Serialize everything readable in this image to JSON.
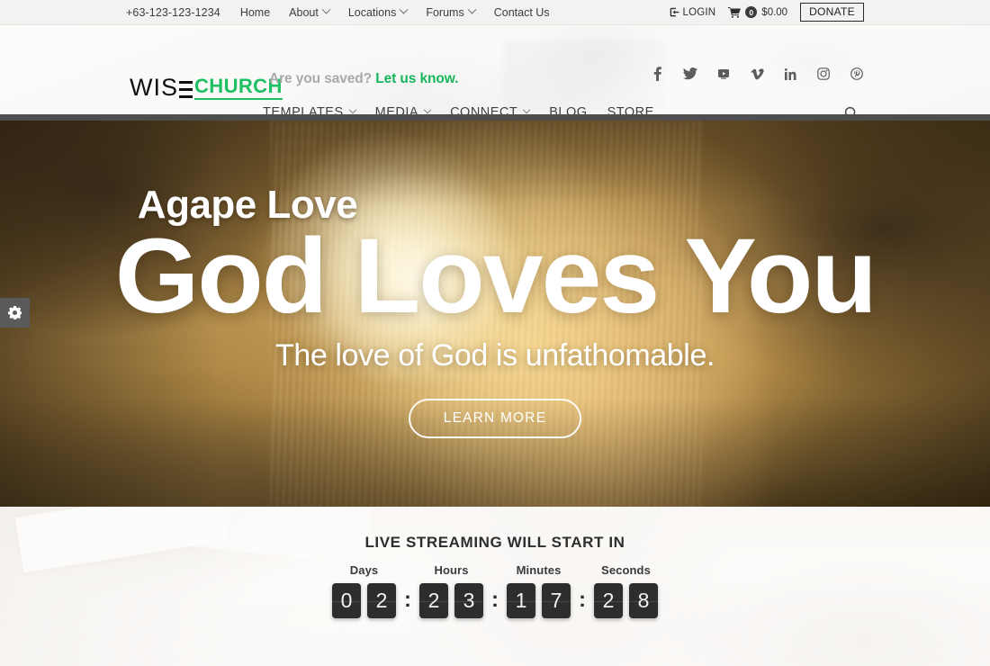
{
  "topbar": {
    "phone": "+63-123-123-1234",
    "nav": [
      {
        "label": "Home",
        "caret": false
      },
      {
        "label": "About",
        "caret": true
      },
      {
        "label": "Locations",
        "caret": true
      },
      {
        "label": "Forums",
        "caret": true
      },
      {
        "label": "Contact Us",
        "caret": false
      }
    ],
    "login_label": "LOGIN",
    "login_icon": "sign-in-icon",
    "cart_icon": "shopping-cart-icon",
    "cart_count": "0",
    "cart_total": "$0.00",
    "donate_label": "DONATE"
  },
  "header": {
    "logo": {
      "word_one": "WISE",
      "word_one_prefix": "WIS",
      "word_two": "CHURCH",
      "accent_color": "#1fbf63"
    },
    "tagline_muted": "Are you saved? ",
    "tagline_accent": "Let us know.",
    "social": [
      {
        "name": "facebook-icon",
        "title": "Facebook"
      },
      {
        "name": "twitter-icon",
        "title": "Twitter"
      },
      {
        "name": "youtube-icon",
        "title": "YouTube"
      },
      {
        "name": "vimeo-icon",
        "title": "Vimeo"
      },
      {
        "name": "linkedin-icon",
        "title": "LinkedIn"
      },
      {
        "name": "instagram-icon",
        "title": "Instagram"
      },
      {
        "name": "pinterest-icon",
        "title": "Pinterest"
      }
    ],
    "mainnav": [
      {
        "label": "TEMPLATES",
        "caret": true
      },
      {
        "label": "MEDIA",
        "caret": true
      },
      {
        "label": "CONNECT",
        "caret": true
      },
      {
        "label": "BLOG",
        "caret": false
      },
      {
        "label": "STORE",
        "caret": false
      }
    ],
    "search_icon": "search-icon"
  },
  "hero": {
    "kicker": "Agape Love",
    "title": "God Loves You",
    "subtitle": "The love of God is unfathomable.",
    "button_label": "LEARN MORE",
    "settings_tab_icon": "gear-icon"
  },
  "countdown": {
    "title": "LIVE STREAMING WILL START IN",
    "separator": ":",
    "units": [
      {
        "label": "Days",
        "digits": [
          "0",
          "2"
        ]
      },
      {
        "label": "Hours",
        "digits": [
          "2",
          "3"
        ]
      },
      {
        "label": "Minutes",
        "digits": [
          "1",
          "7"
        ]
      },
      {
        "label": "Seconds",
        "digits": [
          "2",
          "8"
        ]
      }
    ]
  }
}
